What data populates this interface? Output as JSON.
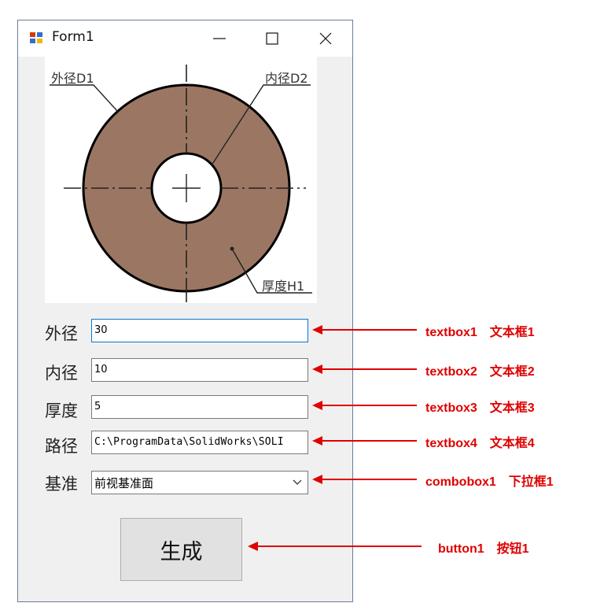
{
  "window": {
    "title": "Form1"
  },
  "diagram": {
    "labels": {
      "outer": "外径D1",
      "inner": "内径D2",
      "thickness": "厚度H1"
    }
  },
  "form": {
    "outer_label": "外径",
    "outer_value": "30",
    "inner_label": "内径",
    "inner_value": "10",
    "thickness_label": "厚度",
    "thickness_value": "5",
    "path_label": "路径",
    "path_value": "C:\\ProgramData\\SolidWorks\\SOLI",
    "plane_label": "基准",
    "plane_value": "前视基准面",
    "button_label": "生成"
  },
  "annotations": [
    {
      "name": "textbox1",
      "desc": "文本框1"
    },
    {
      "name": "textbox2",
      "desc": "文本框2"
    },
    {
      "name": "textbox3",
      "desc": "文本框3"
    },
    {
      "name": "textbox4",
      "desc": "文本框4"
    },
    {
      "name": "combobox1",
      "desc": "下拉框1"
    },
    {
      "name": "button1",
      "desc": "按钮1"
    }
  ],
  "colors": {
    "ring_fill": "#9b7763",
    "annotation_red": "#e00000",
    "focus_border": "#0078d7"
  }
}
